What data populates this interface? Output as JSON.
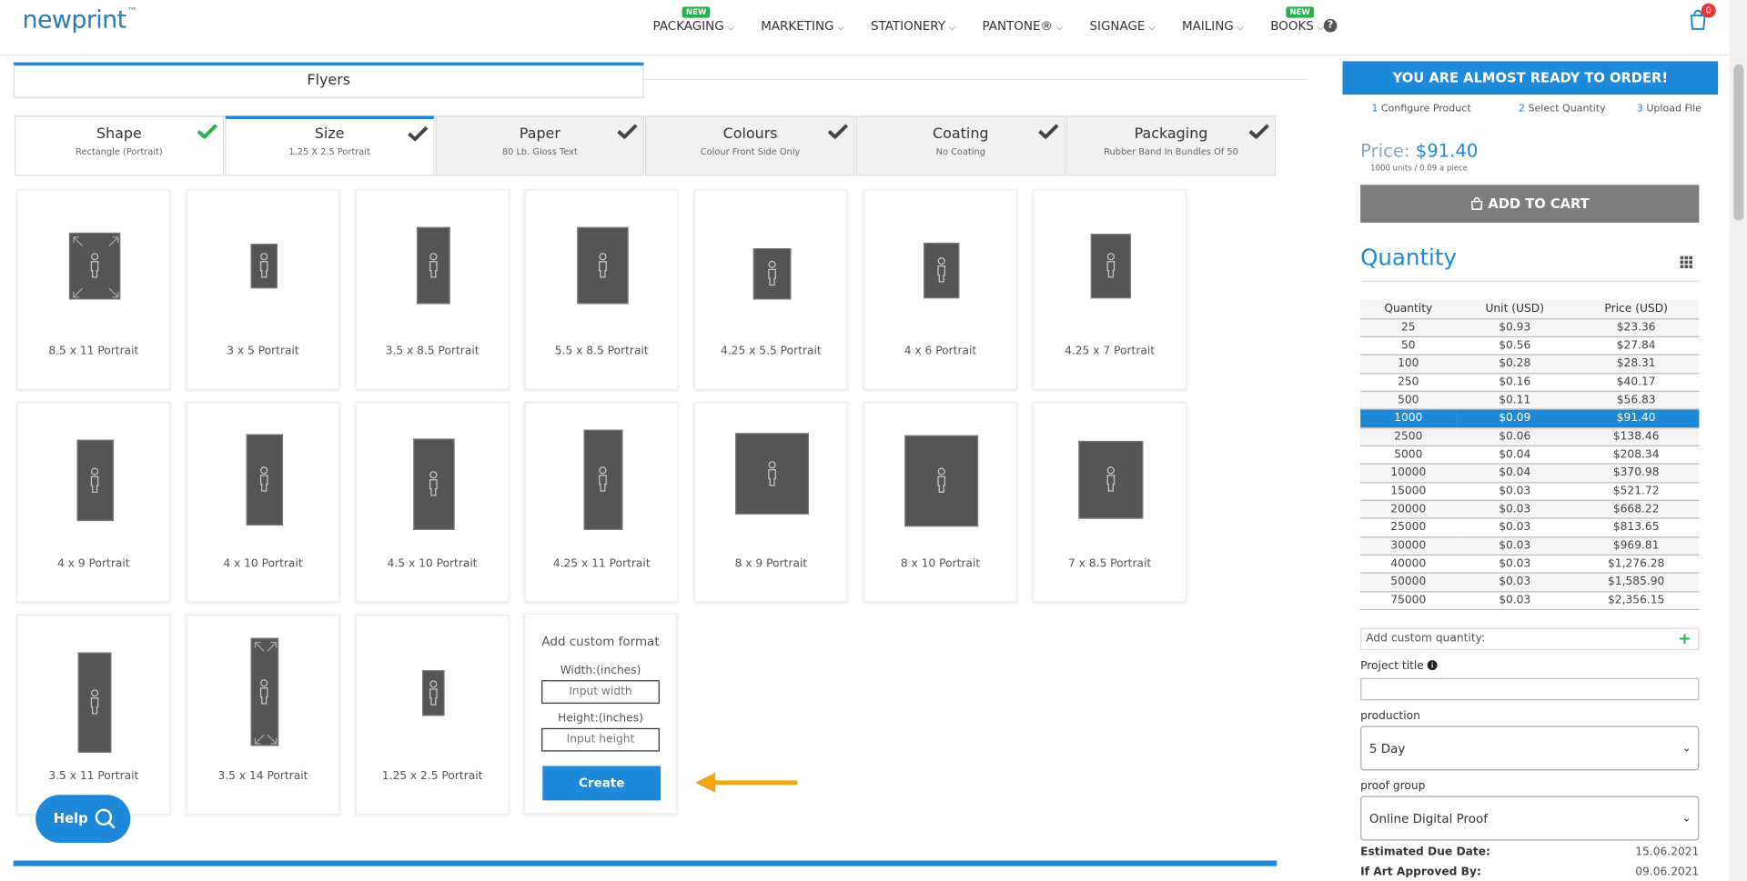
{
  "header": {
    "logo": "newprint",
    "logo_tm": "™",
    "nav": [
      {
        "label": "PACKAGING",
        "badge": "NEW"
      },
      {
        "label": "MARKETING",
        "badge": ""
      },
      {
        "label": "STATIONERY",
        "badge": ""
      },
      {
        "label": "PANTONE®",
        "badge": ""
      },
      {
        "label": "SIGNAGE",
        "badge": ""
      },
      {
        "label": "MAILING",
        "badge": ""
      },
      {
        "label": "BOOKS",
        "badge": "NEW"
      }
    ],
    "help_icon": "?",
    "cart_count": "0"
  },
  "product_tab": "Flyers",
  "steps": [
    {
      "title": "Shape",
      "sub": "Rectangle (Portrait)",
      "check_color": "#23b24b"
    },
    {
      "title": "Size",
      "sub": "1.25 X 2.5 Portrait",
      "check_color": "#444444"
    },
    {
      "title": "Paper",
      "sub": "80 Lb. Gloss Text",
      "check_color": "#444444"
    },
    {
      "title": "Colours",
      "sub": "Colour Front Side Only",
      "check_color": "#444444"
    },
    {
      "title": "Coating",
      "sub": "No Coating",
      "check_color": "#444444"
    },
    {
      "title": "Packaging",
      "sub": "Rubber Band In Bundles Of 50",
      "check_color": "#444444"
    }
  ],
  "sizes": [
    "8.5 x 11 Portrait",
    "3 x 5 Portrait",
    "3.5 x 8.5 Portrait",
    "5.5 x 8.5 Portrait",
    "4.25 x 5.5 Portrait",
    "4 x 6 Portrait",
    "4.25 x 7 Portrait",
    "4 x 9 Portrait",
    "4 x 10 Portrait",
    "4.5 x 10 Portrait",
    "4.25 x 11 Portrait",
    "8 x 9 Portrait",
    "8 x 10 Portrait",
    "7 x 8.5 Portrait",
    "3.5 x 11 Portrait",
    "3.5 x 14 Portrait",
    "1.25 x 2.5 Portrait"
  ],
  "custom": {
    "title": "Add custom format",
    "width_label": "Width:(inches)",
    "width_placeholder": "Input width",
    "height_label": "Height:(inches)",
    "height_placeholder": "Input height",
    "create_label": "Create"
  },
  "help_button": "Help",
  "order": {
    "banner": "YOU ARE ALMOST READY TO ORDER!",
    "steps": [
      {
        "num": "1",
        "label": "Configure Product"
      },
      {
        "num": "2",
        "label": "Select Quantity"
      },
      {
        "num": "3",
        "label": "Upload File"
      }
    ],
    "price_label": "Price:",
    "price_value": "$91.40",
    "price_sub": "1000 units / 0.09 a piece",
    "add_to_cart": "ADD TO CART",
    "quantity_title": "Quantity",
    "table_headers": [
      "Quantity",
      "Unit (USD)",
      "Price (USD)"
    ],
    "rows": [
      [
        "25",
        "$0.93",
        "$23.36"
      ],
      [
        "50",
        "$0.56",
        "$27.84"
      ],
      [
        "100",
        "$0.28",
        "$28.31"
      ],
      [
        "250",
        "$0.16",
        "$40.17"
      ],
      [
        "500",
        "$0.11",
        "$56.83"
      ],
      [
        "1000",
        "$0.09",
        "$91.40"
      ],
      [
        "2500",
        "$0.06",
        "$138.46"
      ],
      [
        "5000",
        "$0.04",
        "$208.34"
      ],
      [
        "10000",
        "$0.04",
        "$370.98"
      ],
      [
        "15000",
        "$0.03",
        "$521.72"
      ],
      [
        "20000",
        "$0.03",
        "$668.22"
      ],
      [
        "25000",
        "$0.03",
        "$813.65"
      ],
      [
        "30000",
        "$0.03",
        "$969.81"
      ],
      [
        "40000",
        "$0.03",
        "$1,276.28"
      ],
      [
        "50000",
        "$0.03",
        "$1,585.90"
      ],
      [
        "75000",
        "$0.03",
        "$2,356.15"
      ]
    ],
    "selected_row": 5,
    "custom_quantity": "Add custom quantity:",
    "project_title_label": "Project title",
    "production_label": "production",
    "production_value": "5 Day",
    "proof_group_label": "proof group",
    "proof_group_value": "Online Digital Proof",
    "estimated_due_label": "Estimated Due Date:",
    "estimated_due_value": "15.06.2021",
    "art_approved_label": "If Art Approved By:",
    "art_approved_value": "09.06.2021"
  },
  "colors": {
    "accent": "#1e88d9",
    "new_badge": "#23b24b",
    "arrow": "#f2a516",
    "cart_gray": "#7d7d7d"
  }
}
